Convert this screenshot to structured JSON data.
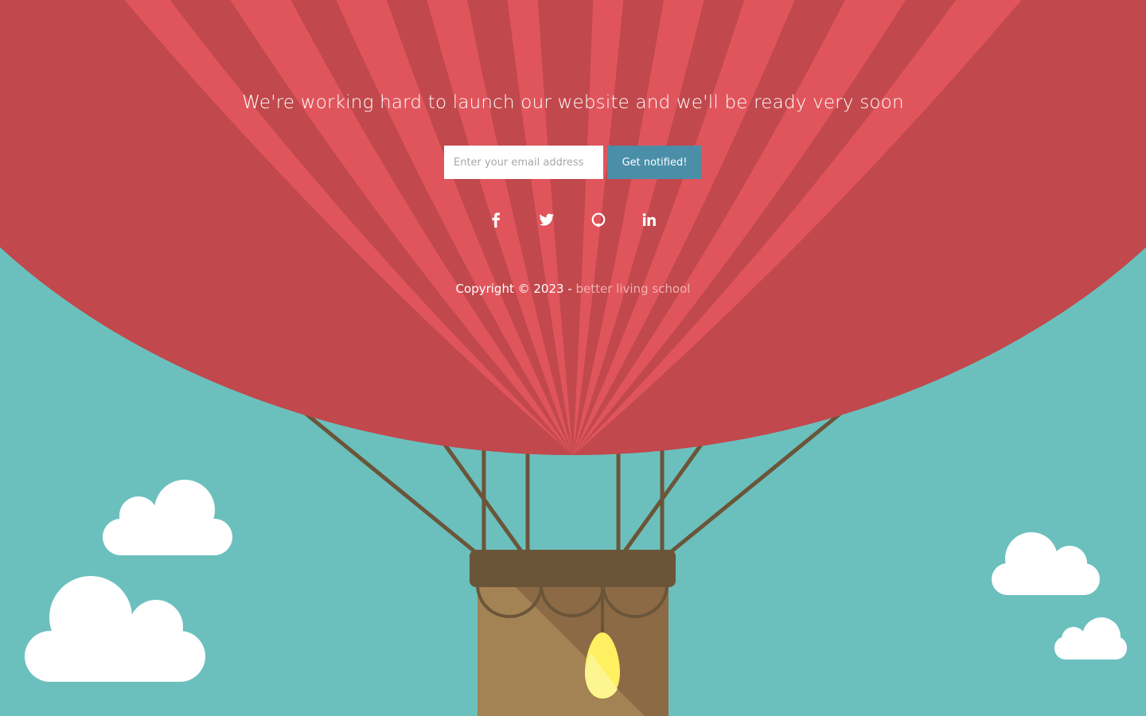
{
  "hero": {
    "headline": "We're working hard to launch our website and we'll be ready very soon"
  },
  "signup": {
    "email_placeholder": "Enter your email address",
    "button_label": "Get notified!"
  },
  "social": [
    {
      "icon": "facebook-icon"
    },
    {
      "icon": "twitter-icon"
    },
    {
      "icon": "github-icon"
    },
    {
      "icon": "linkedin-icon"
    }
  ],
  "footer": {
    "copyright_prefix": "Copyright © 2023 - ",
    "brand_link": "better living school"
  },
  "colors": {
    "sky": "#6bc0bd",
    "balloon_light": "#e0555c",
    "balloon_dark": "#c1484c",
    "rope": "#6b5539",
    "basket": "#a38254",
    "button": "#4a8ea8",
    "link": "#f1b0b2",
    "flame": "#fef060"
  }
}
